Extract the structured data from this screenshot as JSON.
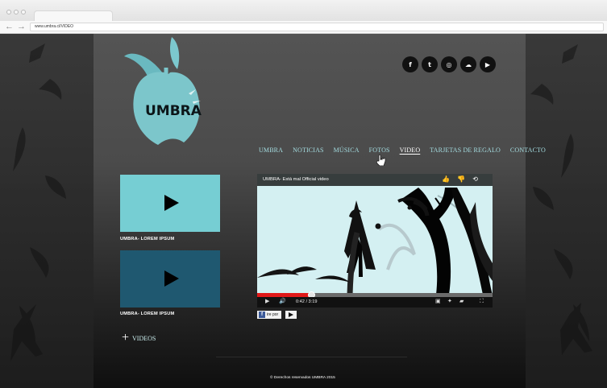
{
  "browser": {
    "address": "www.umbra.cl/VIDEO",
    "back_icon": "back-arrow-icon",
    "forward_icon": "forward-arrow-icon"
  },
  "site": {
    "brand": "UMBRA",
    "accent_color": "#a4dce0",
    "menu": [
      {
        "label": "UMBRA"
      },
      {
        "label": "NOTICIAS"
      },
      {
        "label": "MÚSICA"
      },
      {
        "label": "FOTOS"
      },
      {
        "label": "VIDEO",
        "active": true
      },
      {
        "label": "TARJETAS DE REGALO"
      },
      {
        "label": "CONTACTO"
      }
    ],
    "socials": [
      {
        "name": "facebook-icon",
        "label": "f"
      },
      {
        "name": "twitter-icon",
        "label": "t"
      },
      {
        "name": "instagram-icon",
        "label": "◎"
      },
      {
        "name": "soundcloud-icon",
        "label": "☁"
      },
      {
        "name": "youtube-icon",
        "label": "▶"
      }
    ]
  },
  "videos": {
    "items": [
      {
        "caption": "UMBRA- LOREM IPSUM"
      },
      {
        "caption": "UMBRA- LOREM IPSUM"
      }
    ],
    "more_label": "VIDEOS"
  },
  "player": {
    "title": "UMBRA- Está mal Official video",
    "time_text": "0:42 / 3:19",
    "progress": 0.23
  },
  "share": {
    "facebook_label": "ire por"
  },
  "footer": {
    "text": "© Derechos reservados UMBRA 2015"
  }
}
